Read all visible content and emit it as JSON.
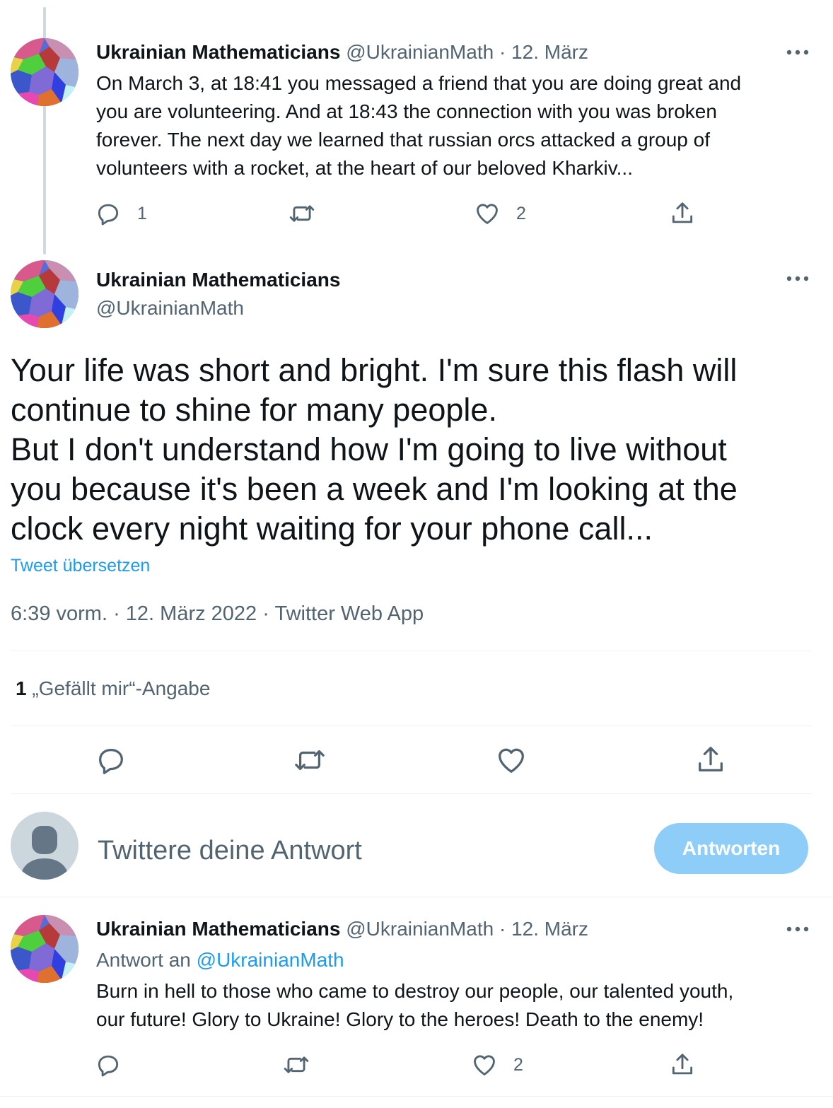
{
  "tweet1": {
    "name": "Ukrainian Mathematicians",
    "handle": "@UkrainianMath",
    "sep": "·",
    "date": "12. März",
    "lines": [
      "On March 3, at 18:41 you messaged a friend that you are doing great and",
      "you are volunteering. And at 18:43 the connection with you was broken",
      "forever.  The next day we learned that russian orcs attacked a group of",
      "volunteers with a rocket, at the heart of our beloved Kharkiv..."
    ],
    "reply_count": "1",
    "like_count": "2",
    "icons": [
      "reply-icon",
      "retweet-icon",
      "like-icon",
      "share-icon",
      "more-icon"
    ]
  },
  "main_tweet": {
    "name": "Ukrainian Mathematicians",
    "handle": "@UkrainianMath",
    "lines": [
      "Your life was short and bright. I'm sure this flash will",
      "continue to shine for many people.",
      "But I don't understand how I'm going to live without",
      "you because it's been a week and I'm looking at the",
      "clock every night waiting for your phone call..."
    ],
    "translate": "Tweet übersetzen",
    "time": "6:39 vorm.",
    "sep": "·",
    "date": "12. März 2022",
    "source": "Twitter Web App",
    "likes_count": "1",
    "likes_label": "„Gefällt mir“-Angabe"
  },
  "composer": {
    "placeholder": "Twittere deine Antwort",
    "button_label": "Antworten",
    "button_color": "#8ecdf8"
  },
  "tweet3": {
    "name": "Ukrainian Mathematicians",
    "handle": "@UkrainianMath",
    "sep": "·",
    "date": "12. März",
    "reply_prefix": "Antwort an",
    "reply_to": "@UkrainianMath",
    "lines": [
      "Burn in hell to those who came to destroy our people, our talented youth,",
      "our future! Glory to Ukraine! Glory to the heroes! Death to the enemy!"
    ],
    "like_count": "2"
  },
  "colors": {
    "text": "#0f1419",
    "muted": "#536471",
    "link": "#1d9bf0",
    "divider": "#eff3f4",
    "thread_line": "#cfd9de"
  }
}
